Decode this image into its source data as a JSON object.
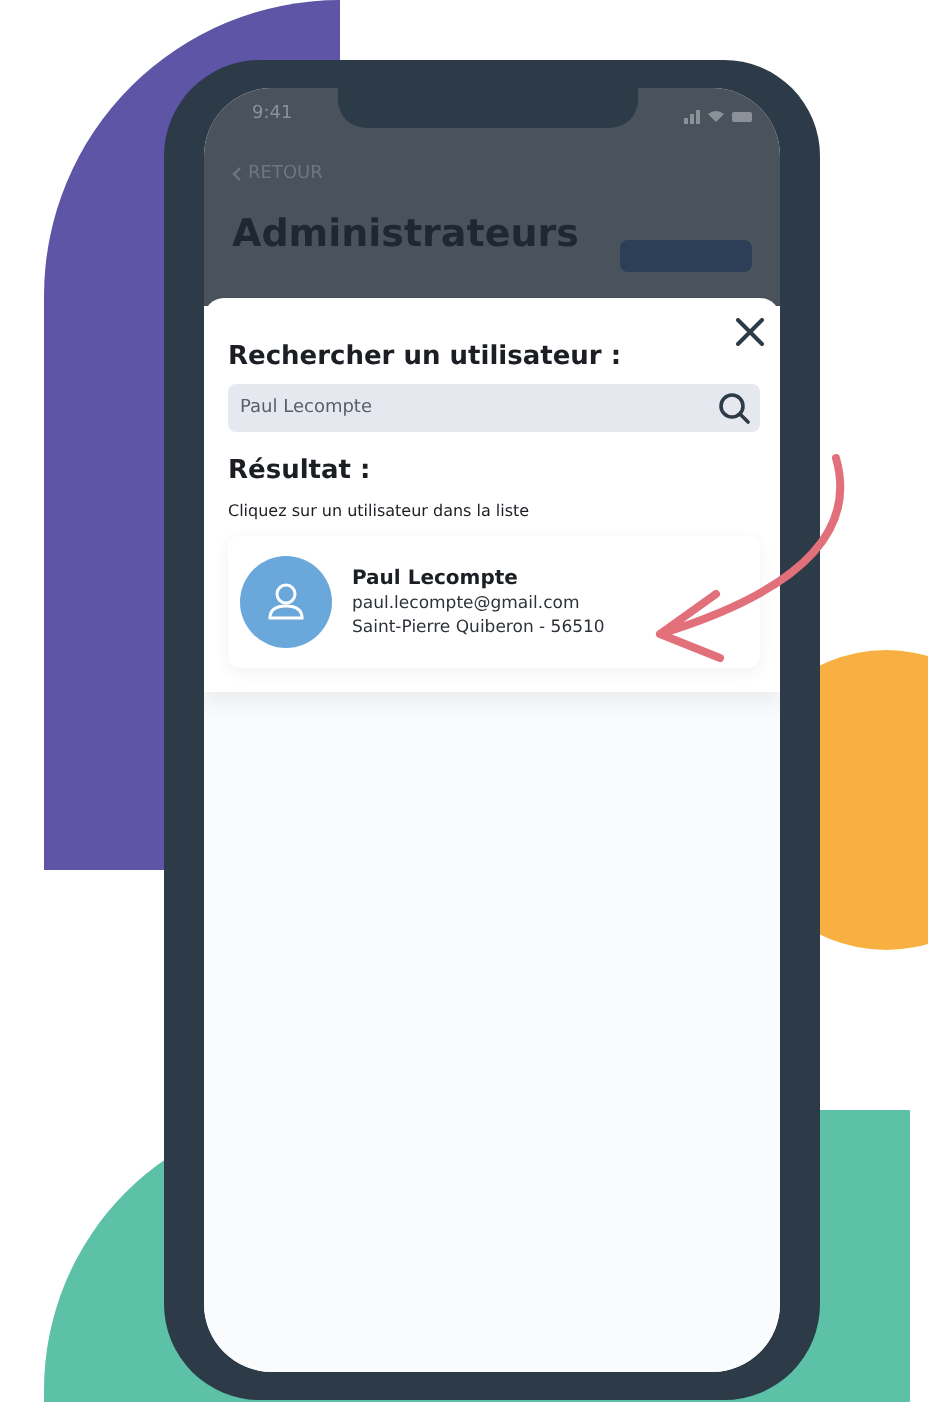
{
  "status_bar": {
    "time": "9:41"
  },
  "back": {
    "label": "RETOUR"
  },
  "page_title": "Administrateurs",
  "modal": {
    "search_title": "Rechercher un utilisateur :",
    "search": {
      "value": "Paul Lecompte"
    },
    "result_title": "Résultat :",
    "hint": "Cliquez sur un utilisateur dans la liste",
    "users": [
      {
        "name": "Paul Lecompte",
        "email": "paul.lecompte@gmail.com",
        "location": "Saint-Pierre Quiberon - 56510"
      }
    ]
  }
}
